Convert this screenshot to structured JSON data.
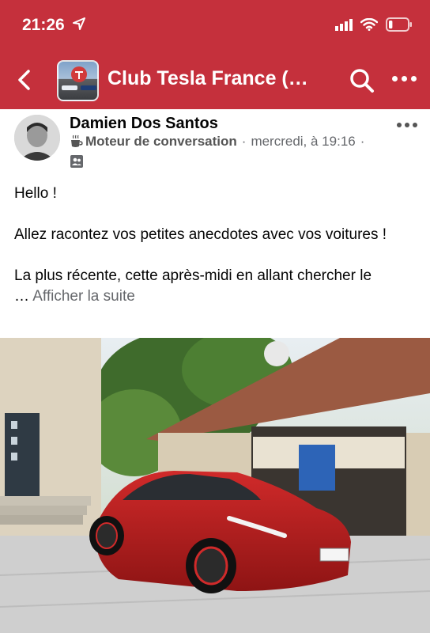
{
  "status_bar": {
    "time": "21:26",
    "location_icon": "location-arrow-icon",
    "signal_icon": "cellular-signal-icon",
    "wifi_icon": "wifi-icon",
    "battery_icon": "battery-icon",
    "battery_level": 0.2
  },
  "header": {
    "back_icon": "back-chevron-icon",
    "group_title": "Club Tesla France (o...",
    "search_icon": "search-icon",
    "more_icon": "more-dots-icon",
    "background_color": "#c5303c"
  },
  "post": {
    "author": "Damien Dos Santos",
    "badge_icon": "coffee-cup-icon",
    "badge": "Moteur de conversation",
    "separator": "·",
    "timestamp": "mercredi, à 19:16",
    "audience_icon": "group-members-icon",
    "text": {
      "line1": "Hello !",
      "line2": "Allez racontez vos petites anecdotes avec vos voitures !",
      "line3": "La plus récente, cette après-midi en allant chercher le",
      "ellipsis": "…",
      "see_more": "Afficher la suite"
    },
    "photo_icon": "car-photo"
  }
}
